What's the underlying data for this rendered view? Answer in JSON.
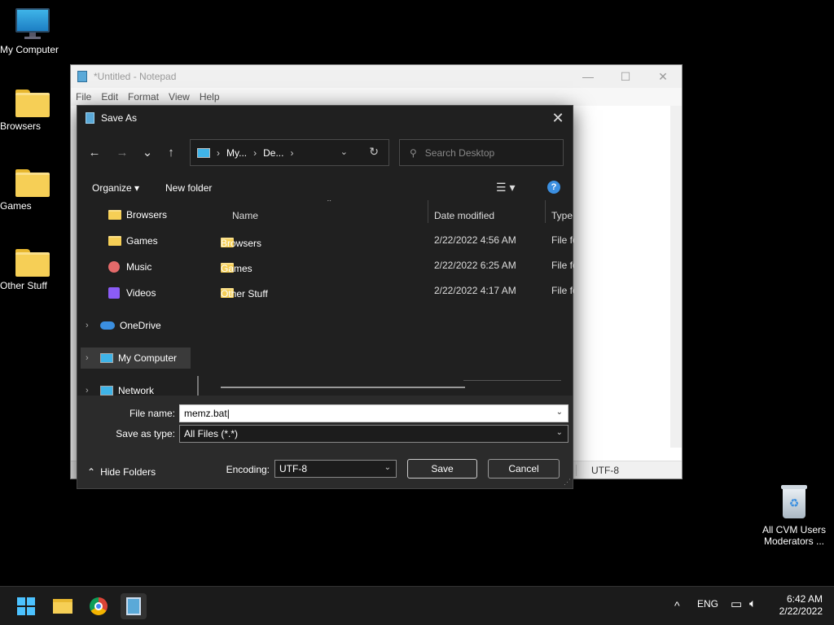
{
  "desktop": {
    "icons": [
      {
        "label": "My Computer",
        "type": "computer"
      },
      {
        "label": "Browsers",
        "type": "folder"
      },
      {
        "label": "Games",
        "type": "folder"
      },
      {
        "label": "Other Stuff",
        "type": "folder"
      }
    ],
    "recycle_bin": {
      "label": "All CVM Users Moderators ..."
    }
  },
  "notepad": {
    "title": "*Untitled - Notepad",
    "menu": [
      "File",
      "Edit",
      "Format",
      "View",
      "Help"
    ],
    "status_encoding": "UTF-8",
    "controls": {
      "minimize": "—",
      "maximize": "☐",
      "close": "✕"
    }
  },
  "dialog": {
    "title": "Save As",
    "close": "✕",
    "nav": {
      "back": "←",
      "forward": "→",
      "recent": "⌄",
      "up": "↑"
    },
    "breadcrumb": [
      "My...",
      "De..."
    ],
    "breadcrumb_sep": "›",
    "search_placeholder": "Search Desktop",
    "toolbar": {
      "organize": "Organize ▾",
      "new_folder": "New folder",
      "help": "?"
    },
    "nav_pane": [
      {
        "label": "Browsers",
        "icon": "folder-icon",
        "indent": true
      },
      {
        "label": "Games",
        "icon": "folder-icon",
        "indent": true
      },
      {
        "label": "Music",
        "icon": "music-icon",
        "indent": true
      },
      {
        "label": "Videos",
        "icon": "video-icon",
        "indent": true
      },
      {
        "label": "OneDrive",
        "icon": "cloud-icon",
        "expandable": true
      },
      {
        "label": "My Computer",
        "icon": "computer-icon",
        "expandable": true,
        "selected": true
      },
      {
        "label": "Network",
        "icon": "network-icon",
        "expandable": true
      }
    ],
    "columns": {
      "name": "Name",
      "date": "Date modified",
      "type": "Type"
    },
    "files": [
      {
        "name": "Browsers",
        "date": "2/22/2022 4:56 AM",
        "type": "File fo"
      },
      {
        "name": "Games",
        "date": "2/22/2022 6:25 AM",
        "type": "File fo"
      },
      {
        "name": "Other Stuff",
        "date": "2/22/2022 4:17 AM",
        "type": "File fo"
      }
    ],
    "filename_label": "File name:",
    "filename_value": "memz.bat",
    "savetype_label": "Save as type:",
    "savetype_value": "All Files  (*.*)",
    "hide_folders": "Hide Folders",
    "encoding_label": "Encoding:",
    "encoding_value": "UTF-8",
    "save": "Save",
    "cancel": "Cancel"
  },
  "taskbar": {
    "language": "ENG",
    "time": "6:42 AM",
    "date": "2/22/2022",
    "tray_chevron": "^"
  },
  "colors": {
    "accent": "#4cc2ff",
    "dialog_bg": "#202020",
    "folder": "#f6cf56"
  }
}
